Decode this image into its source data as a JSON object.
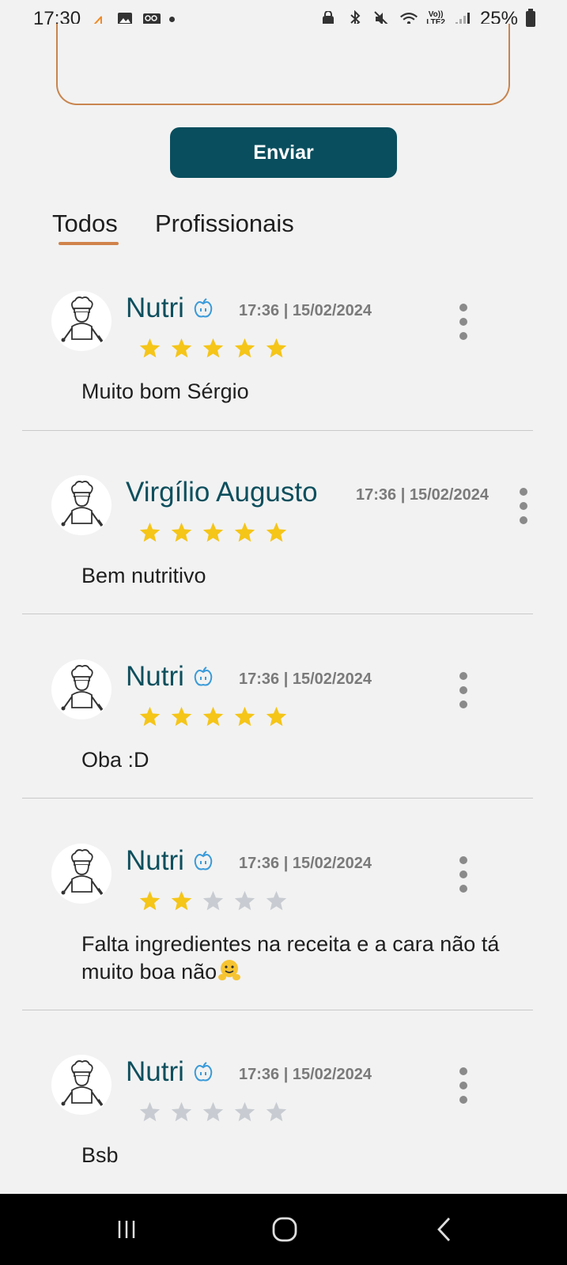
{
  "status_bar": {
    "time": "17:30",
    "battery": "25%",
    "network": "LTE2",
    "volte": "Vo))"
  },
  "comment_form": {
    "send_label": "Enviar"
  },
  "tabs": [
    {
      "label": "Todos",
      "active": true
    },
    {
      "label": "Profissionais",
      "active": false
    }
  ],
  "reviews": [
    {
      "author": "Nutri",
      "verified": true,
      "timestamp": "17:36 | 15/02/2024",
      "rating": 5,
      "text": "Muito bom Sérgio"
    },
    {
      "author": "Virgílio Augusto",
      "verified": false,
      "timestamp": "17:36 | 15/02/2024",
      "rating": 5,
      "text": "Bem nutritivo"
    },
    {
      "author": "Nutri",
      "verified": true,
      "timestamp": "17:36 | 15/02/2024",
      "rating": 5,
      "text": "Oba :D"
    },
    {
      "author": "Nutri",
      "verified": true,
      "timestamp": "17:36 | 15/02/2024",
      "rating": 2,
      "text": "Falta ingredientes na receita e a cara não tá muito boa não"
    },
    {
      "author": "Nutri",
      "verified": true,
      "timestamp": "17:36 | 15/02/2024",
      "rating": 0,
      "text": "Bsb"
    }
  ],
  "colors": {
    "accent": "#094e5e",
    "author": "#0d4f5d",
    "star_filled": "#f5c518",
    "star_empty": "#c8ccd2",
    "tab_underline": "#d0834a",
    "input_border": "#c8854e",
    "verified_icon": "#3a9bd9"
  },
  "icons": {
    "avatar": "chef-icon",
    "verified": "apple-icon",
    "menu": "more-vertical-icon",
    "nav": [
      "recents-icon",
      "home-icon",
      "back-icon"
    ]
  }
}
